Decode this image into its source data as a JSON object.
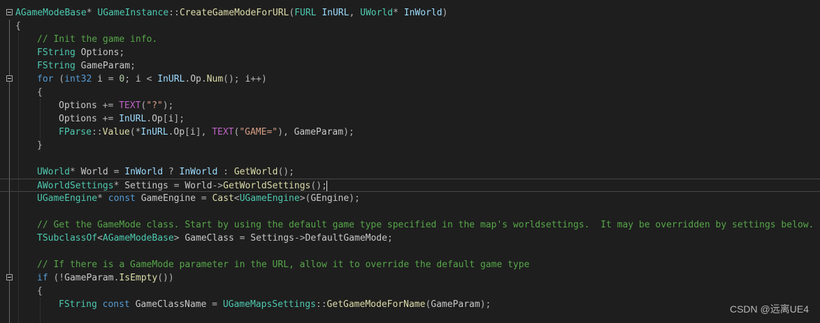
{
  "editor": {
    "lines": [
      {
        "fold": true,
        "indent": 0,
        "tokens": [
          [
            "t",
            "AGameModeBase"
          ],
          [
            "p",
            "* "
          ],
          [
            "t",
            "UGameInstance"
          ],
          [
            "p",
            "::"
          ],
          [
            "f",
            "CreateGameModeForURL"
          ],
          [
            "p",
            "("
          ],
          [
            "t",
            "FURL"
          ],
          [
            "v",
            " InURL"
          ],
          [
            "p",
            ", "
          ],
          [
            "t",
            "UWorld"
          ],
          [
            "p",
            "* "
          ],
          [
            "v",
            "InWorld"
          ],
          [
            "p",
            ")"
          ]
        ]
      },
      {
        "indent": 0,
        "tokens": [
          [
            "p",
            "{"
          ]
        ]
      },
      {
        "indent": 1,
        "tokens": [
          [
            "c",
            "// Init the game info."
          ]
        ]
      },
      {
        "indent": 1,
        "tokens": [
          [
            "t",
            "FString"
          ],
          [
            "v2",
            " Options"
          ],
          [
            "p",
            ";"
          ]
        ]
      },
      {
        "indent": 1,
        "tokens": [
          [
            "t",
            "FString"
          ],
          [
            "v2",
            " GameParam"
          ],
          [
            "p",
            ";"
          ]
        ]
      },
      {
        "fold": true,
        "indent": 1,
        "tokens": [
          [
            "k",
            "for"
          ],
          [
            "p",
            " ("
          ],
          [
            "k",
            "int32"
          ],
          [
            "v2",
            " i"
          ],
          [
            "p",
            " = "
          ],
          [
            "n",
            "0"
          ],
          [
            "p",
            "; "
          ],
          [
            "v2",
            "i"
          ],
          [
            "p",
            " < "
          ],
          [
            "v",
            "InURL"
          ],
          [
            "p",
            "."
          ],
          [
            "v2",
            "Op"
          ],
          [
            "p",
            "."
          ],
          [
            "f",
            "Num"
          ],
          [
            "p",
            "(); "
          ],
          [
            "v2",
            "i"
          ],
          [
            "p",
            "++)"
          ]
        ]
      },
      {
        "indent": 1,
        "tokens": [
          [
            "p",
            "{"
          ]
        ]
      },
      {
        "indent": 2,
        "tokens": [
          [
            "v2",
            "Options"
          ],
          [
            "p",
            " += "
          ],
          [
            "m",
            "TEXT"
          ],
          [
            "p",
            "("
          ],
          [
            "s",
            "\"?\""
          ],
          [
            "p",
            ");"
          ]
        ]
      },
      {
        "indent": 2,
        "tokens": [
          [
            "v2",
            "Options"
          ],
          [
            "p",
            " += "
          ],
          [
            "v",
            "InURL"
          ],
          [
            "p",
            "."
          ],
          [
            "v2",
            "Op"
          ],
          [
            "p",
            "["
          ],
          [
            "v2",
            "i"
          ],
          [
            "p",
            "];"
          ]
        ]
      },
      {
        "indent": 2,
        "tokens": [
          [
            "t",
            "FParse"
          ],
          [
            "p",
            "::"
          ],
          [
            "f",
            "Value"
          ],
          [
            "p",
            "(*"
          ],
          [
            "v",
            "InURL"
          ],
          [
            "p",
            "."
          ],
          [
            "v2",
            "Op"
          ],
          [
            "p",
            "["
          ],
          [
            "v2",
            "i"
          ],
          [
            "p",
            "], "
          ],
          [
            "m",
            "TEXT"
          ],
          [
            "p",
            "("
          ],
          [
            "s",
            "\"GAME=\""
          ],
          [
            "p",
            "), "
          ],
          [
            "v2",
            "GameParam"
          ],
          [
            "p",
            ");"
          ]
        ]
      },
      {
        "indent": 1,
        "tokens": [
          [
            "p",
            "}"
          ]
        ]
      },
      {
        "indent": 1,
        "tokens": []
      },
      {
        "indent": 1,
        "tokens": [
          [
            "t",
            "UWorld"
          ],
          [
            "p",
            "* "
          ],
          [
            "v2",
            "World"
          ],
          [
            "p",
            " = "
          ],
          [
            "v",
            "InWorld"
          ],
          [
            "p",
            " ? "
          ],
          [
            "v",
            "InWorld"
          ],
          [
            "p",
            " : "
          ],
          [
            "f",
            "GetWorld"
          ],
          [
            "p",
            "();"
          ]
        ]
      },
      {
        "indent": 1,
        "current": true,
        "tokens": [
          [
            "t",
            "AWorldSettings"
          ],
          [
            "p",
            "* "
          ],
          [
            "v2",
            "Settings"
          ],
          [
            "p",
            " = "
          ],
          [
            "v2",
            "World"
          ],
          [
            "p",
            "->"
          ],
          [
            "f",
            "GetWorldSettings"
          ],
          [
            "p",
            "();"
          ]
        ]
      },
      {
        "indent": 1,
        "tokens": [
          [
            "t",
            "UGameEngine"
          ],
          [
            "p",
            "* "
          ],
          [
            "k",
            "const"
          ],
          [
            "v2",
            " GameEngine"
          ],
          [
            "p",
            " = "
          ],
          [
            "f",
            "Cast"
          ],
          [
            "p",
            "<"
          ],
          [
            "t",
            "UGameEngine"
          ],
          [
            "p",
            ">("
          ],
          [
            "v2",
            "GEngine"
          ],
          [
            "p",
            ");"
          ]
        ]
      },
      {
        "indent": 1,
        "tokens": []
      },
      {
        "indent": 1,
        "tokens": [
          [
            "c",
            "// Get the GameMode class. Start by using the default game type specified in the map's worldsettings.  It may be overridden by settings below."
          ]
        ]
      },
      {
        "indent": 1,
        "tokens": [
          [
            "t",
            "TSubclassOf"
          ],
          [
            "p",
            "<"
          ],
          [
            "t",
            "AGameModeBase"
          ],
          [
            "p",
            "> "
          ],
          [
            "v2",
            "GameClass"
          ],
          [
            "p",
            " = "
          ],
          [
            "v2",
            "Settings"
          ],
          [
            "p",
            "->"
          ],
          [
            "v2",
            "DefaultGameMode"
          ],
          [
            "p",
            ";"
          ]
        ]
      },
      {
        "indent": 1,
        "tokens": []
      },
      {
        "indent": 1,
        "tokens": [
          [
            "c",
            "// If there is a GameMode parameter in the URL, allow it to override the default game type"
          ]
        ]
      },
      {
        "fold": true,
        "indent": 1,
        "tokens": [
          [
            "k",
            "if"
          ],
          [
            "p",
            " (!"
          ],
          [
            "v2",
            "GameParam"
          ],
          [
            "p",
            "."
          ],
          [
            "f",
            "IsEmpty"
          ],
          [
            "p",
            "())"
          ]
        ]
      },
      {
        "indent": 1,
        "tokens": [
          [
            "p",
            "{"
          ]
        ]
      },
      {
        "indent": 2,
        "tokens": [
          [
            "t",
            "FString"
          ],
          [
            "k",
            " const"
          ],
          [
            "v2",
            " GameClassName"
          ],
          [
            "p",
            " = "
          ],
          [
            "t",
            "UGameMapsSettings"
          ],
          [
            "p",
            "::"
          ],
          [
            "f",
            "GetGameModeForName"
          ],
          [
            "p",
            "("
          ],
          [
            "v2",
            "GameParam"
          ],
          [
            "p",
            ");"
          ]
        ]
      },
      {
        "indent": 2,
        "tokens": []
      }
    ]
  },
  "watermark": "CSDN @远离UE4",
  "icons": {
    "fold": "collapse-minus-icon"
  }
}
